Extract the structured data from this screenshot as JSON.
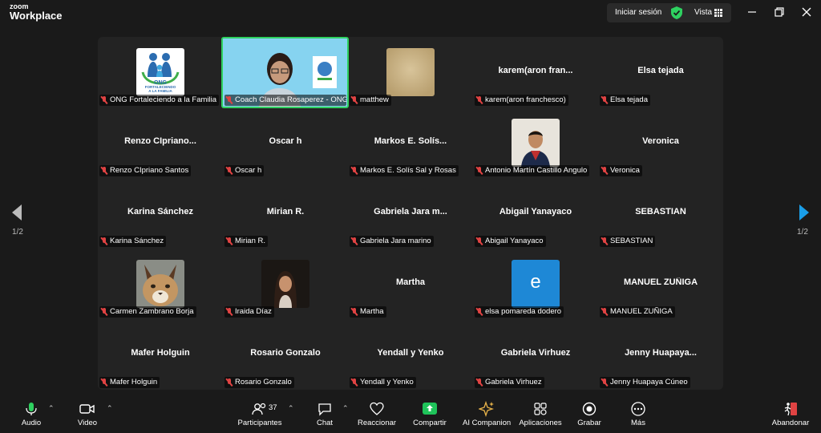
{
  "app": {
    "logo_small": "zoom",
    "logo_large": "Workplace"
  },
  "titlebar": {
    "signin": "Iniciar sesión",
    "view": "Vista"
  },
  "colors": {
    "accent_green": "#2ed160",
    "mute_red": "#e04343",
    "share_green": "#1fc35a"
  },
  "pager": {
    "left_label": "1/2",
    "right_label": "1/2"
  },
  "tiles": [
    {
      "title": "",
      "label": "ONG Fortaleciendo a la Familia",
      "photo": "ong-logo"
    },
    {
      "title": "",
      "label": "Coach Claudia Rosaperez - ONG...",
      "photo": "speaker-video"
    },
    {
      "title": "",
      "label": "matthew",
      "photo": "blurred"
    },
    {
      "title": "karem(aron fran...",
      "label": "karem(aron franchesco)",
      "photo": ""
    },
    {
      "title": "Elsa tejada",
      "label": "Elsa tejada",
      "photo": ""
    },
    {
      "title": "Renzo  CIpriano...",
      "label": "Renzo CIpriano Santos",
      "photo": ""
    },
    {
      "title": "Oscar h",
      "label": "Oscar h",
      "photo": ""
    },
    {
      "title": "Markos  E.  Solís...",
      "label": "Markos E. Solís Sal y Rosas",
      "photo": ""
    },
    {
      "title": "",
      "label": "Antonio Martín Castillo Angulo",
      "photo": "boy"
    },
    {
      "title": "Veronica",
      "label": "Veronica",
      "photo": ""
    },
    {
      "title": "Karina Sánchez",
      "label": "Karina Sánchez",
      "photo": ""
    },
    {
      "title": "Mirian R.",
      "label": "Mirian R.",
      "photo": ""
    },
    {
      "title": "Gabriela  Jara  m...",
      "label": "Gabriela Jara marino",
      "photo": ""
    },
    {
      "title": "Abigail Yanayaco",
      "label": "Abigail Yanayaco",
      "photo": ""
    },
    {
      "title": "SEBASTIAN",
      "label": "SEBASTIAN",
      "photo": ""
    },
    {
      "title": "",
      "label": "Carmen Zambrano Borja",
      "photo": "caracal"
    },
    {
      "title": "",
      "label": "Iraida Díaz",
      "photo": "woman"
    },
    {
      "title": "Martha",
      "label": "Martha",
      "photo": ""
    },
    {
      "title": "",
      "label": "elsa pomareda dodero",
      "photo": "letter-e"
    },
    {
      "title": "MANUEL ZUÑIGA",
      "label": "MANUEL ZUÑIGA",
      "photo": ""
    },
    {
      "title": "Mafer Holguin",
      "label": "Mafer Holguin",
      "photo": ""
    },
    {
      "title": "Rosario Gonzalo",
      "label": "Rosario Gonzalo",
      "photo": ""
    },
    {
      "title": "Yendall y Yenko",
      "label": "Yendall y Yenko",
      "photo": ""
    },
    {
      "title": "Gabriela Virhuez",
      "label": "Gabriela Virhuez",
      "photo": ""
    },
    {
      "title": "Jenny  Huapaya...",
      "label": "Jenny Huapaya Cúneo",
      "photo": ""
    }
  ],
  "ong_logo": {
    "line1": "ONG",
    "line2": "FORTALECIENDO",
    "line3": "A LA FAMILIA"
  },
  "avatar_letter": "e",
  "toolbar": {
    "audio": "Audio",
    "video": "Video",
    "participants": "Participantes",
    "participants_count": "37",
    "chat": "Chat",
    "react": "Reaccionar",
    "share": "Compartir",
    "ai": "AI Companion",
    "apps": "Aplicaciones",
    "record": "Grabar",
    "more": "Más",
    "leave": "Abandonar"
  }
}
